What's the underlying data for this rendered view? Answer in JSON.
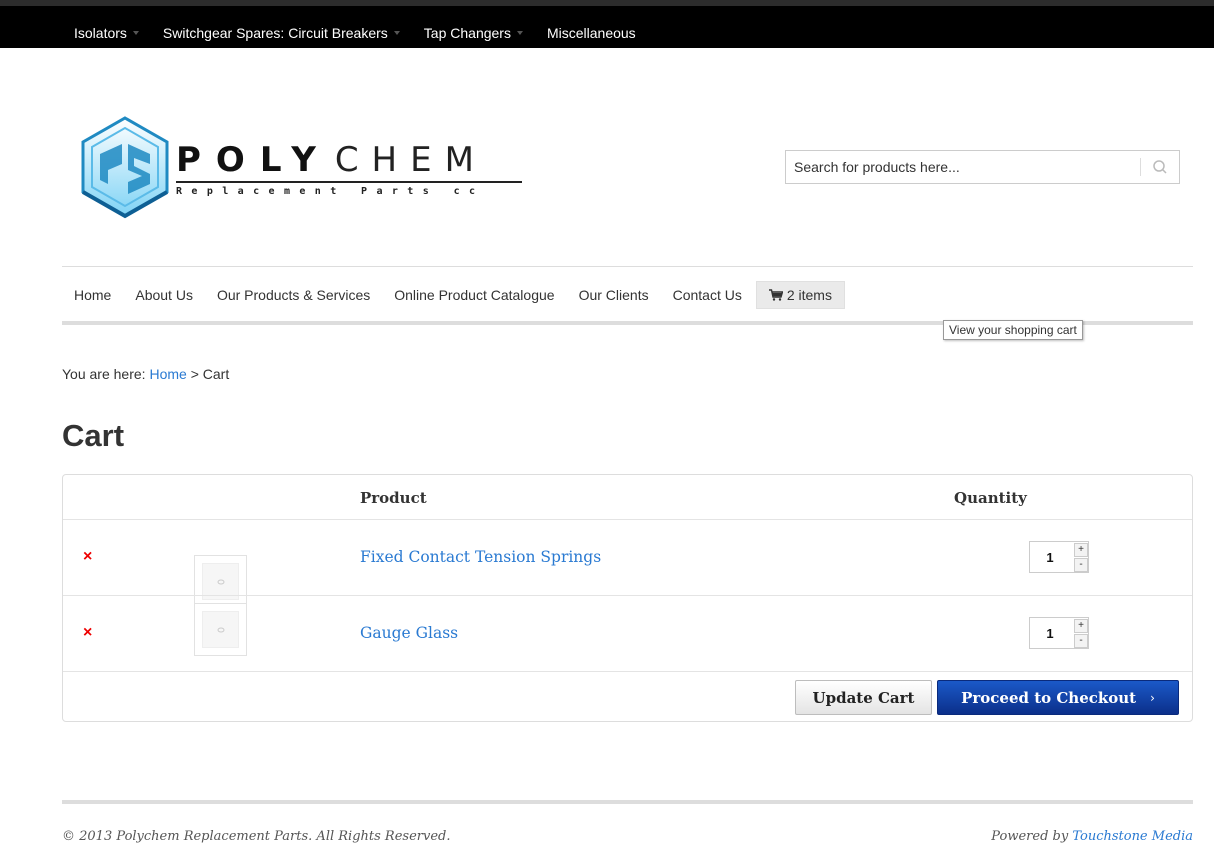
{
  "top_nav": {
    "items": [
      {
        "label": "Isolators",
        "has_dropdown": true
      },
      {
        "label": "Switchgear Spares: Circuit Breakers",
        "has_dropdown": true
      },
      {
        "label": "Tap Changers",
        "has_dropdown": true
      },
      {
        "label": "Miscellaneous",
        "has_dropdown": false
      }
    ]
  },
  "logo": {
    "word_bold": "POLY",
    "word_light": "CHEM",
    "subtitle": "Replacement Parts cc",
    "colors": {
      "hex_light": "#7fd3f5",
      "hex_dark": "#1f8ac2"
    }
  },
  "search": {
    "placeholder": "Search for products here...",
    "icon": "search-icon"
  },
  "main_nav": {
    "items": [
      "Home",
      "About Us",
      "Our Products & Services",
      "Online Product Catalogue",
      "Our Clients",
      "Contact Us"
    ],
    "cart_label": "2 items",
    "cart_icon": "cart-icon",
    "tooltip": "View your shopping cart"
  },
  "breadcrumb": {
    "prefix": "You are here: ",
    "home": "Home",
    "separator": " > ",
    "current": "Cart"
  },
  "page": {
    "title": "Cart"
  },
  "cart": {
    "headers": {
      "product": "Product",
      "quantity": "Quantity"
    },
    "rows": [
      {
        "remove": "×",
        "product": "Fixed Contact Tension Springs",
        "quantity": "1"
      },
      {
        "remove": "×",
        "product": "Gauge Glass",
        "quantity": "1"
      }
    ],
    "qty_up": "+",
    "qty_down": "-",
    "update_label": "Update Cart",
    "checkout_label": "Proceed to Checkout",
    "checkout_chevron": "›"
  },
  "colors": {
    "link": "#2a7ad2",
    "checkout": "#0b2f8a",
    "remove": "#ee0000"
  },
  "footer": {
    "copyright": "© 2013 Polychem Replacement Parts. All Rights Reserved.",
    "powered_prefix": "Powered by ",
    "powered_link": "Touchstone Media"
  }
}
